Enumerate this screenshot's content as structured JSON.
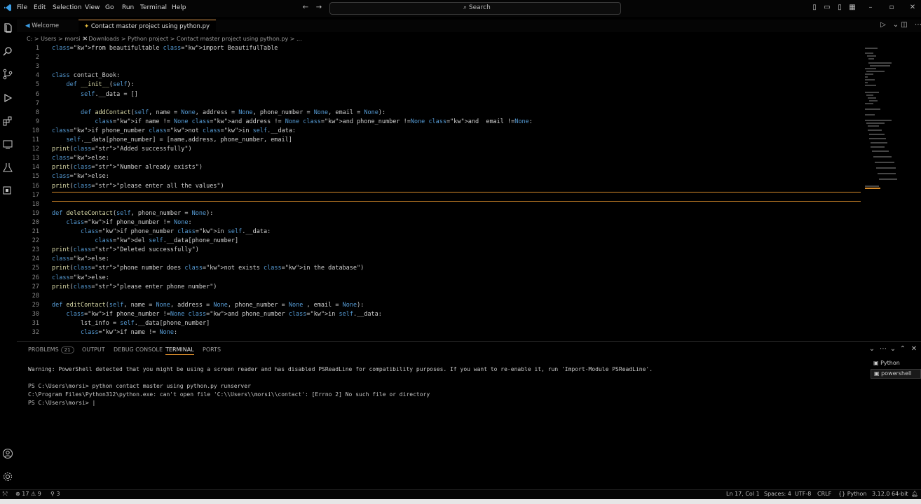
{
  "menu": [
    "File",
    "Edit",
    "Selection",
    "View",
    "Go",
    "Run",
    "Terminal",
    "Help"
  ],
  "search": {
    "label": "Search"
  },
  "tabs": [
    {
      "label": "Welcome"
    },
    {
      "label": "Contact master project using python.py"
    }
  ],
  "breadcrumb": "C: > Users > morsi > Downloads > Python project > Contact master project using python.py > ...",
  "code_lines": [
    {
      "n": "1",
      "text": "from beautifultable import BeautifulTable"
    },
    {
      "n": "2",
      "text": ""
    },
    {
      "n": "3",
      "text": ""
    },
    {
      "n": "4",
      "text": "class contact_Book:"
    },
    {
      "n": "5",
      "text": "    def __init__(self):"
    },
    {
      "n": "6",
      "text": "        self.__data = []"
    },
    {
      "n": "7",
      "text": ""
    },
    {
      "n": "8",
      "text": "        def addContact(self, name = None, address = None, phone_number = None, email = None):"
    },
    {
      "n": "9",
      "text": "            if name != None and address != None and phone_number !=None and  email !=None:"
    },
    {
      "n": "10",
      "text": "if phone_number not in self.__data:"
    },
    {
      "n": "11",
      "text": "    self.__data[phone_number] = [name,address, phone_number, email]"
    },
    {
      "n": "12",
      "text": "print(\"Added successfully\")"
    },
    {
      "n": "13",
      "text": "else:"
    },
    {
      "n": "14",
      "text": "print(\"Number already exists\")"
    },
    {
      "n": "15",
      "text": "else:"
    },
    {
      "n": "16",
      "text": "print(\"please enter all the values\")"
    },
    {
      "n": "17",
      "text": ""
    },
    {
      "n": "18",
      "text": ""
    },
    {
      "n": "19",
      "text": "def deleteContact(self, phone_number = None):"
    },
    {
      "n": "20",
      "text": "    if phone_number != None:"
    },
    {
      "n": "21",
      "text": "        if phone_number in self.__data:"
    },
    {
      "n": "22",
      "text": "            del self.__data[phone_number]"
    },
    {
      "n": "23",
      "text": "print(\"Deleted successfully\")"
    },
    {
      "n": "24",
      "text": "else:"
    },
    {
      "n": "25",
      "text": "print(\"phone number does not exists in the database\")"
    },
    {
      "n": "26",
      "text": "else:"
    },
    {
      "n": "27",
      "text": "print(\"please enter phone number\")"
    },
    {
      "n": "28",
      "text": ""
    },
    {
      "n": "29",
      "text": "def editContact(self, name = None, address = None, phone_number = None , email = None):"
    },
    {
      "n": "30",
      "text": "    if phone_number !=None and phone_number in self.__data:"
    },
    {
      "n": "31",
      "text": "        lst_info = self.__data[phone_number]"
    },
    {
      "n": "32",
      "text": "        if name != None:"
    }
  ],
  "panel": {
    "tabs": [
      "PROBLEMS",
      "OUTPUT",
      "DEBUG CONSOLE",
      "TERMINAL",
      "PORTS"
    ],
    "problem_count": "21",
    "terminal_lines": [
      "Warning: PowerShell detected that you might be using a screen reader and has disabled PSReadLine for compatibility purposes. If you want to re-enable it, run 'Import-Module PSReadLine'.",
      "",
      "PS C:\\Users\\morsi> python contact master using python.py runserver",
      "C:\\Program Files\\Python312\\python.exe: can't open file 'C:\\\\Users\\\\morsi\\\\contact': [Errno 2] No such file or directory",
      "PS C:\\Users\\morsi> |"
    ],
    "terminal_list": [
      "Python",
      "powershell"
    ]
  },
  "status": {
    "errors": "17",
    "warnings": "9",
    "ports": "3",
    "cursor": "Ln 17, Col 1",
    "spaces": "Spaces: 4",
    "encoding": "UTF-8",
    "eol": "CRLF",
    "language": "Python",
    "interpreter": "3.12.0 64-bit"
  },
  "colors": {
    "accent": "#d68a2a",
    "background": "#000000",
    "text": "#cccccc"
  }
}
